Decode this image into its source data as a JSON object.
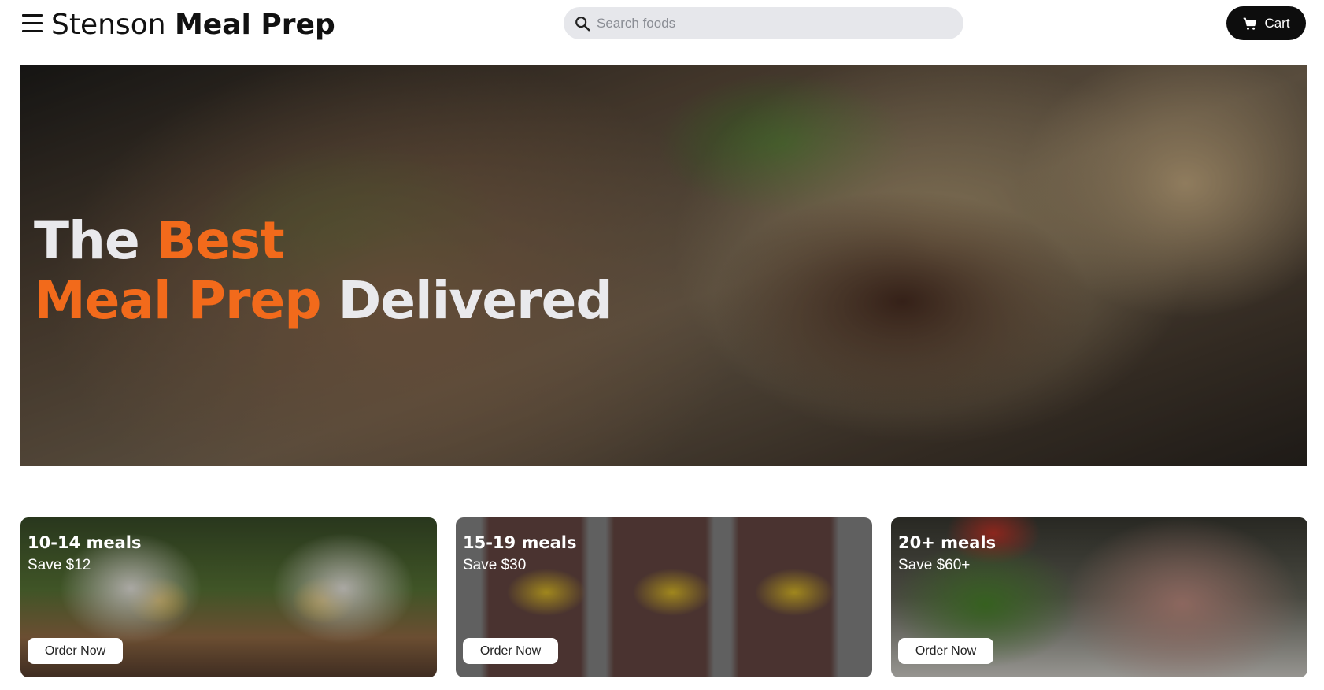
{
  "header": {
    "brand_first": "Stenson",
    "brand_second": "Meal Prep",
    "search_placeholder": "Search foods",
    "cart_label": "Cart"
  },
  "hero": {
    "line1_a": "The",
    "line1_b": "Best",
    "line2_a": "Meal Prep",
    "line2_b": "Delivered"
  },
  "cards": [
    {
      "title": "10-14 meals",
      "subtitle": "Save $12",
      "button": "Order Now"
    },
    {
      "title": "15-19 meals",
      "subtitle": "Save $30",
      "button": "Order Now"
    },
    {
      "title": "20+ meals",
      "subtitle": "Save $60+",
      "button": "Order Now"
    }
  ],
  "colors": {
    "accent": "#f26a1b",
    "cart_bg": "#0d0d0d",
    "search_bg": "#e6e7eb"
  },
  "icons": [
    "menu-icon",
    "search-icon",
    "cart-icon"
  ]
}
